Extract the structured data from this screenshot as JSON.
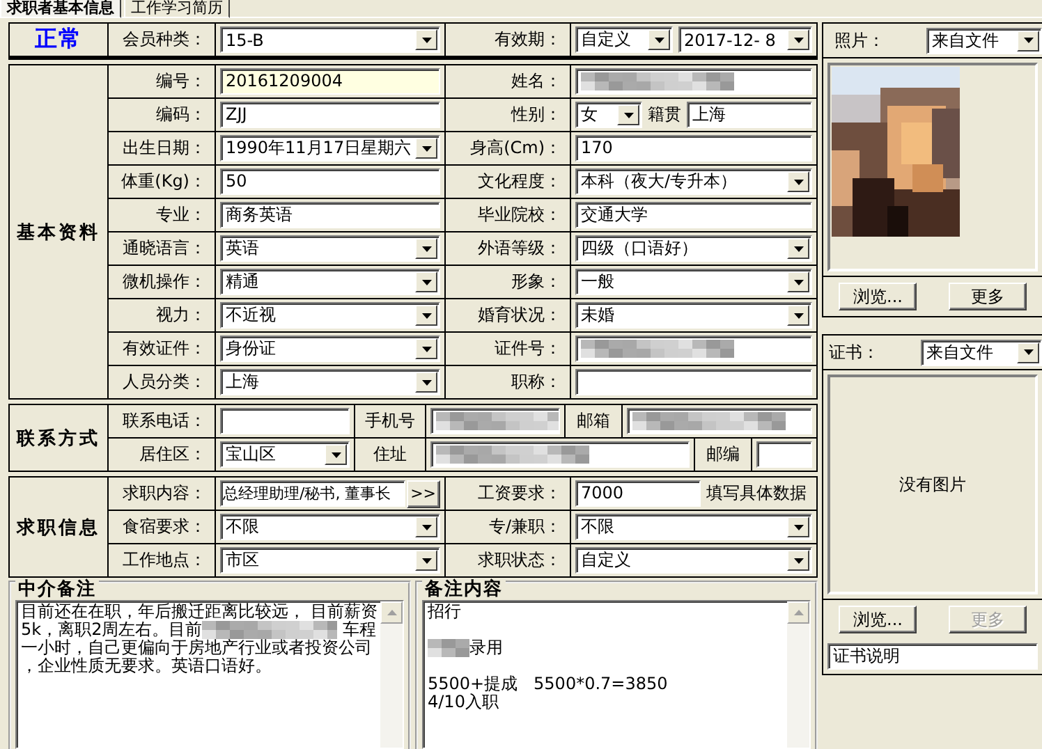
{
  "tabs": [
    {
      "label": "求职者基本信息",
      "selected": true
    },
    {
      "label": "工作学习简历",
      "selected": false
    }
  ],
  "sections": [
    {
      "title": "正常",
      "kind": "header",
      "rows": [
        [
          {
            "label": "会员种类：",
            "kind": "dropdown",
            "value": "15-B"
          },
          {
            "label": "有效期：",
            "kind": "dual",
            "value": "自定义",
            "date": "2017-12- 8"
          }
        ]
      ]
    },
    {
      "title": "基本资料",
      "kind": "grid",
      "rows": [
        [
          {
            "label": "编号：",
            "kind": "text",
            "value": "20161209004",
            "highlighted": true
          },
          {
            "label": "姓名：",
            "kind": "redacted"
          }
        ],
        [
          {
            "label": "编码：",
            "kind": "text",
            "value": "ZJJ"
          },
          {
            "label": "性别：",
            "kind": "dropdown",
            "value": "女",
            "extra": {
              "label": "籍贯",
              "value": "上海"
            }
          }
        ],
        [
          {
            "label": "出生日期：",
            "kind": "dropdown",
            "value": "1990年11月17日星期六"
          },
          {
            "label": "身高(Cm)：",
            "kind": "text",
            "value": "170"
          }
        ],
        [
          {
            "label": "体重(Kg)：",
            "kind": "text",
            "value": "50"
          },
          {
            "label": "文化程度：",
            "kind": "dropdown",
            "value": "本科（夜大/专升本）"
          }
        ],
        [
          {
            "label": "专业：",
            "kind": "text",
            "value": "商务英语"
          },
          {
            "label": "毕业院校：",
            "kind": "text",
            "value": "交通大学"
          }
        ],
        [
          {
            "label": "通晓语言：",
            "kind": "dropdown",
            "value": "英语"
          },
          {
            "label": "外语等级：",
            "kind": "dropdown",
            "value": "四级（口语好）"
          }
        ],
        [
          {
            "label": "微机操作：",
            "kind": "dropdown",
            "value": "精通"
          },
          {
            "label": "形象：",
            "kind": "dropdown",
            "value": "一般"
          }
        ],
        [
          {
            "label": "视力：",
            "kind": "dropdown",
            "value": "不近视"
          },
          {
            "label": "婚育状况：",
            "kind": "dropdown",
            "value": "未婚"
          }
        ],
        [
          {
            "label": "有效证件：",
            "kind": "dropdown",
            "value": "身份证"
          },
          {
            "label": "证件号：",
            "kind": "redacted"
          }
        ],
        [
          {
            "label": "人员分类：",
            "kind": "dropdown",
            "value": "上海"
          },
          {
            "label": "职称：",
            "kind": "text"
          }
        ]
      ]
    },
    {
      "title": "联系方式",
      "kind": "contact",
      "rows": [
        [
          {
            "label": "联系电话：",
            "kind": "text"
          },
          {
            "label": "手机号",
            "kind": "redacted"
          },
          {
            "label": "邮箱",
            "kind": "redacted"
          }
        ],
        [
          {
            "label": "居住区：",
            "kind": "dropdown",
            "value": "宝山区"
          },
          {
            "label": "住址",
            "kind": "redacted"
          },
          {
            "label": "邮编",
            "kind": "text"
          }
        ]
      ]
    },
    {
      "title": "求职信息",
      "kind": "grid",
      "rows": [
        [
          {
            "label": "求职内容：",
            "kind": "picker",
            "value": "总经理助理/秘书, 董事长",
            "button": ">>"
          },
          {
            "label": "工资要求：",
            "kind": "text",
            "value": "7000",
            "note": "填写具体数据"
          }
        ],
        [
          {
            "label": "食宿要求：",
            "kind": "dropdown",
            "value": "不限"
          },
          {
            "label": "专/兼职：",
            "kind": "dropdown",
            "value": "不限"
          }
        ],
        [
          {
            "label": "工作地点：",
            "kind": "dropdown",
            "value": "市区"
          },
          {
            "label": "求职状态：",
            "kind": "dropdown",
            "value": "自定义"
          }
        ]
      ]
    }
  ],
  "notes": [
    {
      "title": "中介备注",
      "lines": [
        {
          "kind": "line",
          "parts": [
            {
              "kind": "text",
              "text": "目前还在在职，年后搬迁距离比较远， 目前薪资"
            }
          ]
        },
        {
          "kind": "line",
          "parts": [
            {
              "kind": "text",
              "text": "5k，离职2周左右。目前"
            },
            {
              "kind": "redacted"
            },
            {
              "kind": "text",
              "text": " 车程"
            }
          ]
        },
        {
          "kind": "line",
          "parts": [
            {
              "kind": "text",
              "text": "一小时，自己更偏向于房地产行业或者投资公司"
            }
          ]
        },
        {
          "kind": "line",
          "parts": [
            {
              "kind": "text",
              "text": "，企业性质无要求。英语口语好。"
            }
          ]
        }
      ]
    },
    {
      "title": "备注内容",
      "lines": [
        {
          "kind": "line",
          "parts": [
            {
              "kind": "text",
              "text": "招行"
            }
          ]
        },
        {
          "kind": "blank"
        },
        {
          "kind": "line",
          "parts": [
            {
              "kind": "redacted"
            },
            {
              "kind": "text",
              "text": "录用"
            }
          ]
        },
        {
          "kind": "blank"
        },
        {
          "kind": "line",
          "parts": [
            {
              "kind": "text",
              "text": "5500+提成   5500*0.7=3850"
            }
          ]
        },
        {
          "kind": "line",
          "parts": [
            {
              "kind": "text",
              "text": "4/10入职"
            }
          ]
        }
      ]
    }
  ],
  "photo": {
    "label": "照片：",
    "source": "来自文件",
    "buttons": [
      {
        "label": "浏览...",
        "disabled": false
      },
      {
        "label": "更多",
        "disabled": false
      }
    ]
  },
  "certificate": {
    "label": "证书：",
    "source": "来自文件",
    "empty_text": "没有图片",
    "buttons": [
      {
        "label": "浏览...",
        "disabled": false
      },
      {
        "label": "更多",
        "disabled": true
      }
    ],
    "description": "证书说明"
  }
}
